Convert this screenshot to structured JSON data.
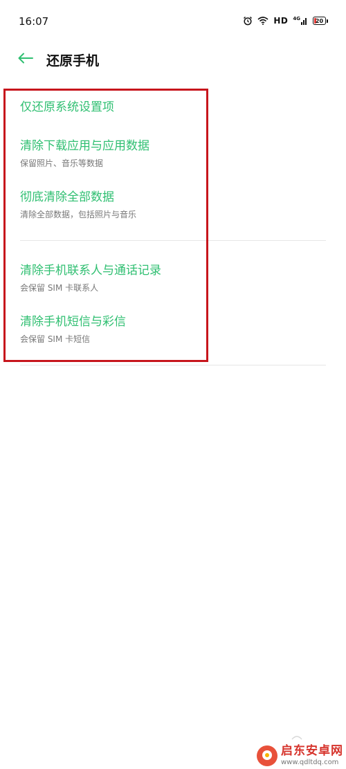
{
  "status_bar": {
    "time": "16:07",
    "hd_label": "HD",
    "network_label": "4G",
    "battery_level": "20",
    "icons": [
      "alarm-icon",
      "wifi-icon",
      "signal-icon",
      "battery-icon"
    ]
  },
  "header": {
    "back_icon": "arrow-left-icon",
    "title": "还原手机"
  },
  "options": [
    {
      "title": "仅还原系统设置项",
      "subtitle": ""
    },
    {
      "title": "清除下载应用与应用数据",
      "subtitle": "保留照片、音乐等数据"
    },
    {
      "title": "彻底清除全部数据",
      "subtitle": "清除全部数据，包括照片与音乐"
    },
    {
      "title": "清除手机联系人与通话记录",
      "subtitle": "会保留 SIM 卡联系人"
    },
    {
      "title": "清除手机短信与彩信",
      "subtitle": "会保留 SIM 卡短信"
    }
  ],
  "watermark": {
    "name": "启东安卓网",
    "url": "www.qdltdq.com"
  },
  "colors": {
    "accent_green": "#2fbf71",
    "highlight_red": "#c7151c",
    "battery_low": "#e53935"
  }
}
